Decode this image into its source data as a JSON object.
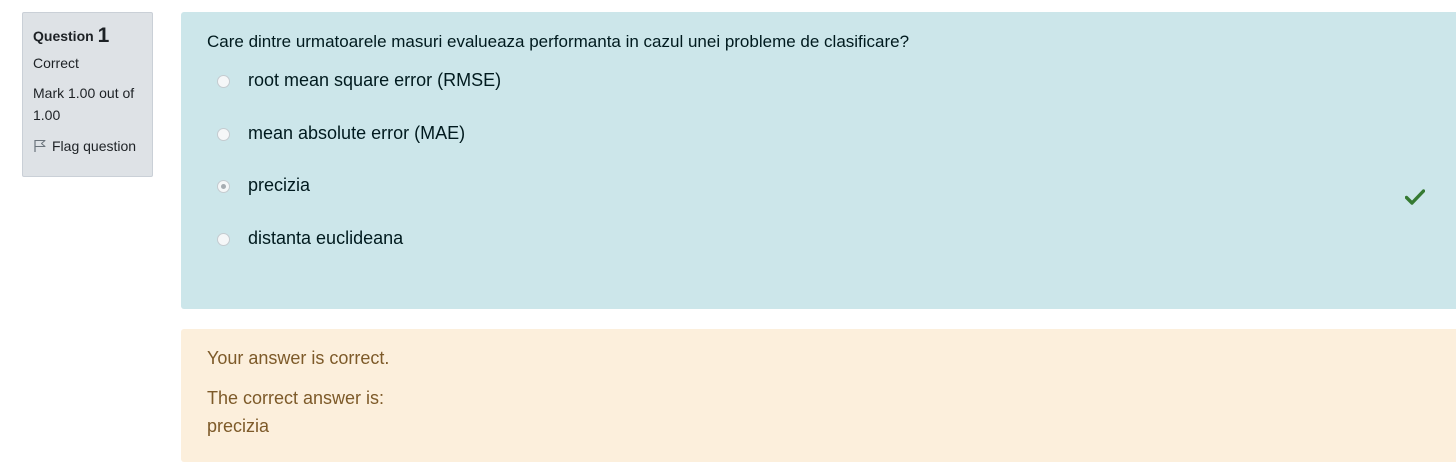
{
  "info": {
    "question_prefix": "Question",
    "question_number": "1",
    "state": "Correct",
    "grade": "Mark 1.00 out of 1.00",
    "flag_label": "Flag question"
  },
  "question": {
    "text": "Care dintre urmatoarele masuri evalueaza performanta in cazul unei probleme de clasificare?",
    "answers": [
      {
        "label": "root mean square error (RMSE)",
        "selected": false
      },
      {
        "label": "mean absolute error (MAE)",
        "selected": false
      },
      {
        "label": "precizia",
        "selected": true
      },
      {
        "label": "distanta euclideana",
        "selected": false
      }
    ],
    "correct_mark_icon": "checkmark-icon"
  },
  "outcome": {
    "feedback": "Your answer is correct.",
    "right_answer_intro": "The correct answer is:",
    "right_answer": "precizia"
  },
  "colors": {
    "formulation_bg": "#cce6ea",
    "outcome_bg": "#fcefdc",
    "info_bg": "#dee2e6",
    "check_color": "#357a32"
  }
}
